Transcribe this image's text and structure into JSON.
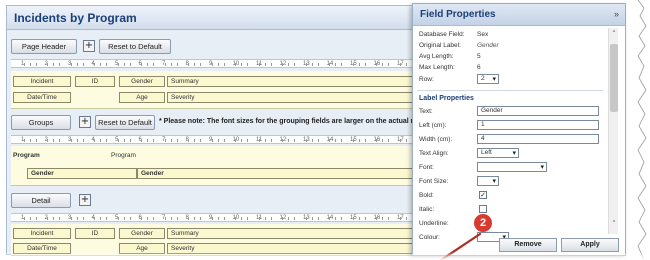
{
  "designer": {
    "title": "Incidents by Program",
    "page_header": {
      "label": "Page Header",
      "plus": "+",
      "reset": "Reset to Default"
    },
    "groups": {
      "label": "Groups",
      "plus": "+",
      "reset": "Reset to Default"
    },
    "note": "* Please note: The font sizes for the grouping fields are larger on the actual report.",
    "detail": {
      "label": "Detail",
      "plus": "+"
    },
    "ruler_ticks": [
      "1",
      "2",
      "3",
      "4",
      "5",
      "6",
      "7",
      "8",
      "9",
      "10",
      "11",
      "12",
      "13",
      "14",
      "15",
      "16",
      "17"
    ],
    "header_row1": [
      "Incident",
      "ID",
      "Gender",
      "Summary"
    ],
    "header_row2": [
      "Date/Time",
      "Age",
      "Severity"
    ],
    "group_row1": {
      "label": "Program",
      "value": "Program"
    },
    "group_row2": {
      "label": "Gender",
      "value": "Gender"
    },
    "detail_row1": [
      "Incident",
      "ID",
      "Gender",
      "Summary"
    ],
    "detail_row2": [
      "Date/Time",
      "Age",
      "Severity"
    ]
  },
  "panel": {
    "title": "Field Properties",
    "close": "»",
    "database_field": {
      "label": "Database Field:",
      "value": "Sex"
    },
    "original_label": {
      "label": "Original Label:",
      "value": "Gender"
    },
    "avg_length": {
      "label": "Avg Length:",
      "value": "5"
    },
    "max_length": {
      "label": "Max Length:",
      "value": "6"
    },
    "row": {
      "label": "Row:",
      "value": "2"
    },
    "label_properties": "Label Properties",
    "text": {
      "label": "Text:",
      "value": "Gender"
    },
    "left": {
      "label": "Left (cm):",
      "value": "1"
    },
    "width": {
      "label": "Width (cm):",
      "value": "4"
    },
    "text_align": {
      "label": "Text Align:",
      "value": "Left"
    },
    "font": {
      "label": "Font:",
      "value": ""
    },
    "font_size": {
      "label": "Font Size:",
      "value": ""
    },
    "bold": {
      "label": "Bold:",
      "checked": true
    },
    "italic": {
      "label": "Italic:",
      "checked": false
    },
    "underline": {
      "label": "Underline:",
      "checked": false
    },
    "colour": {
      "label": "Colour:",
      "value": ""
    },
    "remove": "Remove",
    "apply": "Apply",
    "callout": "2"
  },
  "colors": {
    "callout": "#d93a2f",
    "title": "#1b3f77",
    "field_fill": "#fbf8cf"
  }
}
